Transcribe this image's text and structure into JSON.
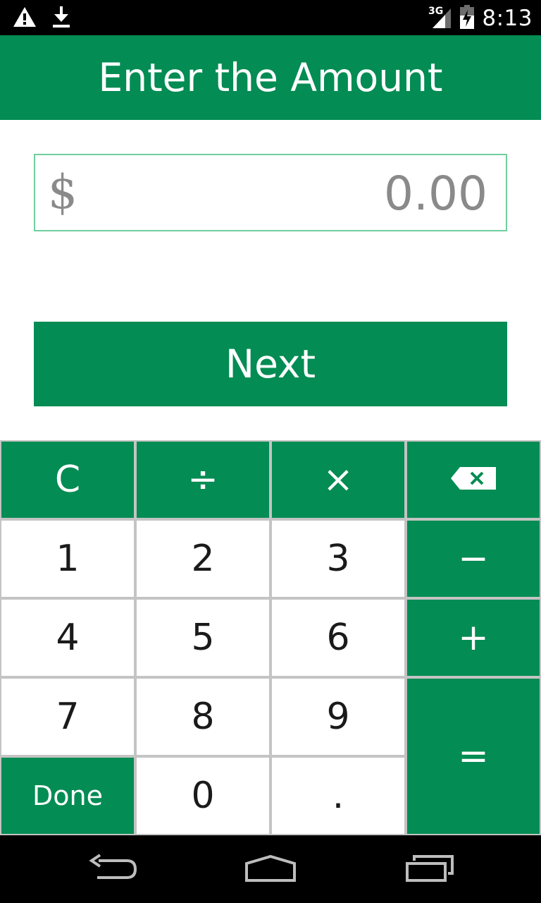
{
  "status_bar": {
    "time": "8:13",
    "network": "3G",
    "icons": [
      "warning-icon",
      "download-icon",
      "signal-icon",
      "battery-icon"
    ]
  },
  "app_bar": {
    "title": "Enter the Amount"
  },
  "amount_field": {
    "currency": "$",
    "value": "0.00"
  },
  "next_button": {
    "label": "Next"
  },
  "keypad": {
    "clear": "C",
    "divide": "÷",
    "multiply": "×",
    "backspace": "backspace-icon",
    "one": "1",
    "two": "2",
    "three": "3",
    "minus": "−",
    "four": "4",
    "five": "5",
    "six": "6",
    "plus": "+",
    "seven": "7",
    "eight": "8",
    "nine": "9",
    "equals": "=",
    "done": "Done",
    "zero": "0",
    "dot": "."
  },
  "colors": {
    "primary": "#038c53",
    "field_border": "#6fcf9f",
    "placeholder_text": "#8a8a8a",
    "key_divider": "#c4c4c4"
  },
  "nav_bar": {
    "icons": [
      "back-icon",
      "home-icon",
      "recents-icon"
    ]
  }
}
